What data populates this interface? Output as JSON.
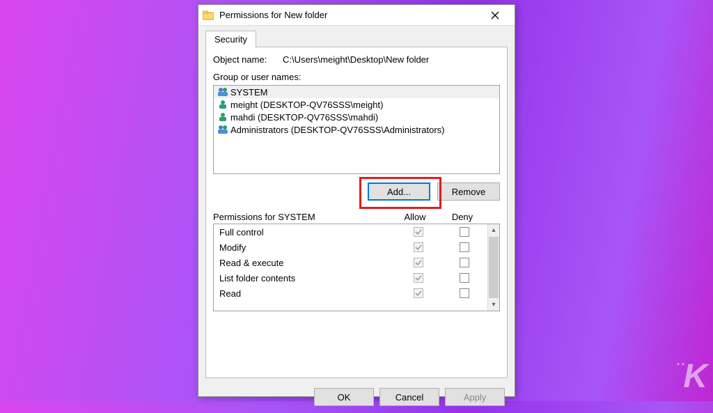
{
  "window": {
    "title": "Permissions for New folder"
  },
  "tab": {
    "security": "Security"
  },
  "object": {
    "label": "Object name:",
    "path": "C:\\Users\\meight\\Desktop\\New folder"
  },
  "groups": {
    "label": "Group or user names:",
    "items": [
      {
        "name": "SYSTEM",
        "icon": "group"
      },
      {
        "name": "meight (DESKTOP-QV76SSS\\meight)",
        "icon": "user"
      },
      {
        "name": "mahdi (DESKTOP-QV76SSS\\mahdi)",
        "icon": "user"
      },
      {
        "name": "Administrators (DESKTOP-QV76SSS\\Administrators)",
        "icon": "group"
      }
    ]
  },
  "buttons": {
    "add": "Add...",
    "remove": "Remove",
    "ok": "OK",
    "cancel": "Cancel",
    "apply": "Apply"
  },
  "permissions": {
    "header": "Permissions for SYSTEM",
    "allow": "Allow",
    "deny": "Deny",
    "rows": [
      {
        "name": "Full control",
        "allow": true,
        "deny": false
      },
      {
        "name": "Modify",
        "allow": true,
        "deny": false
      },
      {
        "name": "Read & execute",
        "allow": true,
        "deny": false
      },
      {
        "name": "List folder contents",
        "allow": true,
        "deny": false
      },
      {
        "name": "Read",
        "allow": true,
        "deny": false
      }
    ]
  },
  "watermark": "K"
}
